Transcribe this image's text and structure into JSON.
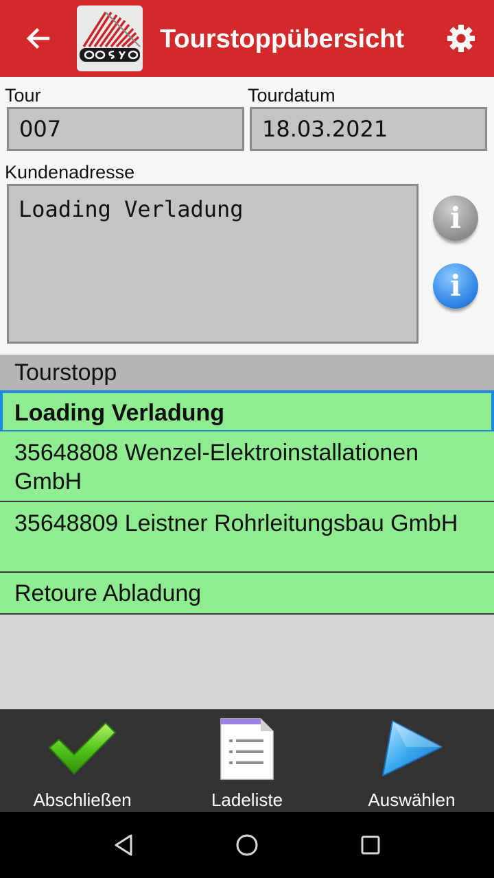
{
  "appbar": {
    "title": "Tourstoppübersicht",
    "back_icon": "arrow-left-icon",
    "logo_text": "cosys",
    "settings_icon": "gear-icon",
    "color": "#d2292a"
  },
  "form": {
    "tour_label": "Tour",
    "tour_value": "007",
    "date_label": "Tourdatum",
    "date_value": "18.03.2021",
    "address_label": "Kundenadresse",
    "address_value": "Loading Verladung"
  },
  "info_buttons": [
    {
      "icon": "info-icon",
      "color": "#8d8d8d"
    },
    {
      "icon": "info-icon",
      "color": "#2f86e6"
    }
  ],
  "list": {
    "header": "Tourstopp",
    "row_color": "#90ec90",
    "selected_border": "#1e88e5",
    "items": [
      {
        "label": "Loading Verladung",
        "selected": true
      },
      {
        "label": "35648808 Wenzel-Elektroinstallationen GmbH",
        "selected": false
      },
      {
        "label": "35648809 Leistner Rohrleitungsbau GmbH",
        "selected": false
      },
      {
        "label": "Retoure Abladung",
        "selected": false
      }
    ]
  },
  "bottom_actions": [
    {
      "label": "Abschließen",
      "icon": "checkmark-icon"
    },
    {
      "label": "Ladeliste",
      "icon": "document-list-icon"
    },
    {
      "label": "Auswählen",
      "icon": "play-arrow-icon"
    }
  ],
  "system_nav": {
    "back_icon": "nav-back-icon",
    "home_icon": "nav-home-icon",
    "recents_icon": "nav-recents-icon"
  }
}
